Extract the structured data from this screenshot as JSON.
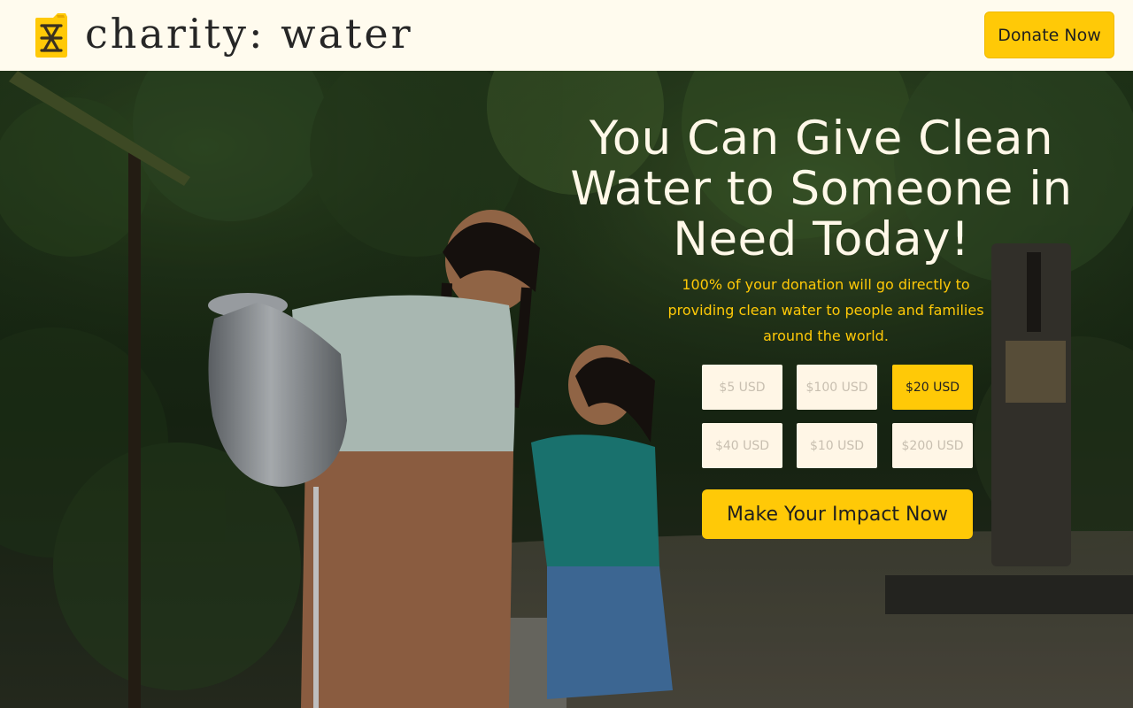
{
  "header": {
    "logo_icon": "jerrycan-icon",
    "logo_text": "charity: water",
    "donate_label": "Donate Now"
  },
  "hero": {
    "headline": "You Can Give Clean Water to Someone in Need Today!",
    "subtext": "100% of your donation will go directly to providing clean water to people and families around the world.",
    "amounts": [
      {
        "label": "$5 USD",
        "selected": false
      },
      {
        "label": "$100 USD",
        "selected": false
      },
      {
        "label": "$20 USD",
        "selected": true
      },
      {
        "label": "$40 USD",
        "selected": false
      },
      {
        "label": "$10 USD",
        "selected": false
      },
      {
        "label": "$200 USD",
        "selected": false
      }
    ],
    "cta_label": "Make Your Impact Now",
    "background_image": "photo of two girls smiling at each other, the older one carrying a metal water jug, in a green forest path near a water pump"
  },
  "colors": {
    "brand_yellow": "#ffc907",
    "header_bg": "#fffbee",
    "amount_button_bg": "#fff6e6",
    "headline_text": "#fff8e8",
    "dark_text": "#1f1f1f"
  }
}
